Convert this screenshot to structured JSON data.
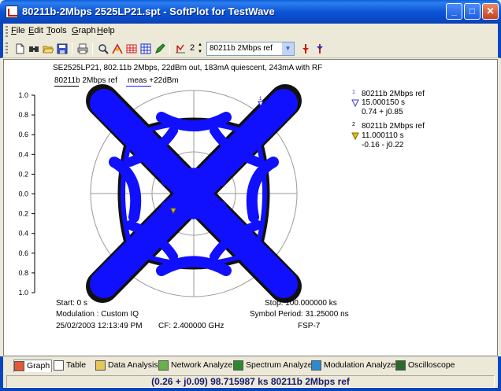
{
  "window": {
    "title": "80211b-2Mbps 2525LP21.spt - SoftPlot for TestWave",
    "minimize_label": "_",
    "maximize_label": "□",
    "close_label": "✕"
  },
  "menu": [
    "File",
    "Edit",
    "Tools",
    "Graph",
    "Help"
  ],
  "toolbar": {
    "icons": [
      "new-icon",
      "find-icon",
      "open-icon",
      "save-icon",
      "print-icon",
      "zoom-icon",
      "marker-icon",
      "table-icon",
      "grid-icon",
      "edit-icon",
      "trace-icon"
    ],
    "spin_value": "2",
    "trace_select": "80211b 2Mbps ref",
    "colors": {
      "red": "#cc1a1a",
      "blue": "#1a2fcc"
    }
  },
  "plot": {
    "header": "SE2525LP21, 802.11b 2Mbps, 22dBm out, 183mA quiescent, 243mA with RF",
    "legend": [
      {
        "label": "80211b 2Mbps ref",
        "color": "#000000"
      },
      {
        "label": "meas +22dBm",
        "color": "#1a1aff"
      }
    ],
    "y_ticks": [
      "1.0",
      "0.8",
      "0.6",
      "0.4",
      "0.2",
      "0.0",
      "0.2",
      "0.4",
      "0.6",
      "0.8",
      "1.0"
    ],
    "markers": [
      {
        "index": "1",
        "trace": "80211b 2Mbps ref",
        "time": "15.000150 s",
        "value": "0.74 + j0.85",
        "color": "#3b3bd6"
      },
      {
        "index": "2",
        "trace": "80211b 2Mbps ref",
        "time": "11.000110 s",
        "value": "-0.16 - j0.22",
        "color": "#e0c400"
      }
    ],
    "footer": {
      "start": "Start: 0 s",
      "stop": "Stop: 100.000000 ks",
      "modulation": "Modulation : Custom IQ",
      "symbol_period": "Symbol Period: 31.25000 ns",
      "datetime": "25/02/2003 12:13:49 PM",
      "cf": "CF: 2.400000 GHz",
      "instrument": "FSP-7"
    },
    "colors": {
      "trace_blue": "#1010ff",
      "trace_black": "#000000",
      "circle": "#9a9a9a"
    }
  },
  "tabs": [
    {
      "label": "Graph",
      "icon": "graph-icon",
      "active": true
    },
    {
      "label": "Table",
      "icon": "table-icon"
    },
    {
      "label": "Data Analysis",
      "icon": "data-analysis-icon"
    },
    {
      "label": "Network Analyzer",
      "icon": "network-analyzer-icon"
    },
    {
      "label": "Spectrum Analyzer",
      "icon": "spectrum-analyzer-icon"
    },
    {
      "label": "Modulation Analyzer",
      "icon": "modulation-analyzer-icon"
    },
    {
      "label": "Oscilloscope",
      "icon": "oscilloscope-icon"
    }
  ],
  "status": "(0.26 + j0.09)  98.715987 ks  80211b 2Mbps ref"
}
